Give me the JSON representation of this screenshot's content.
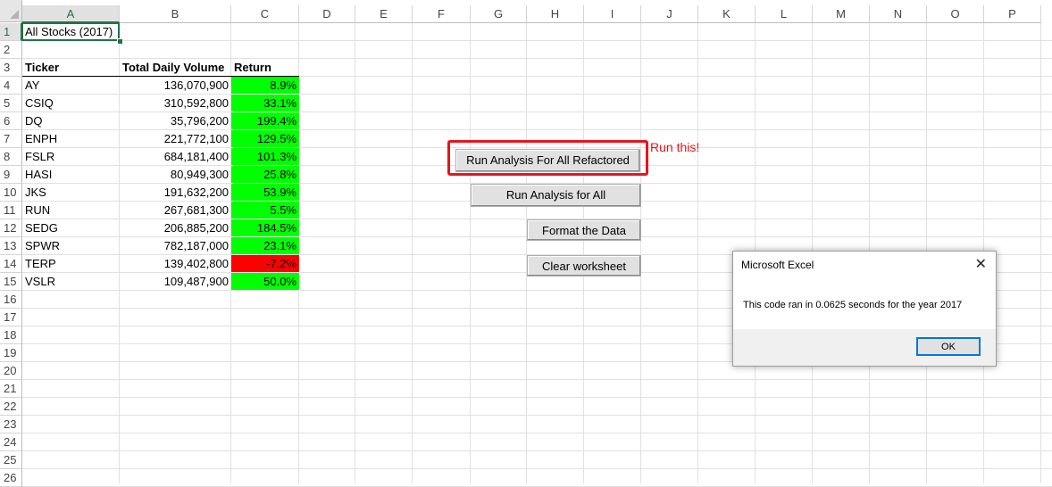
{
  "columns": [
    "A",
    "B",
    "C",
    "D",
    "E",
    "F",
    "G",
    "H",
    "I",
    "J",
    "K",
    "L",
    "M",
    "N",
    "O",
    "P"
  ],
  "rows": [
    "1",
    "2",
    "3",
    "4",
    "5",
    "6",
    "7",
    "8",
    "9",
    "10",
    "11",
    "12",
    "13",
    "14",
    "15",
    "16",
    "17",
    "18",
    "19",
    "20",
    "21",
    "22",
    "23",
    "24",
    "25",
    "26"
  ],
  "sheet": {
    "title": "All Stocks (2017)",
    "headers": {
      "ticker": "Ticker",
      "volume": "Total Daily Volume",
      "return": "Return"
    },
    "data": [
      {
        "ticker": "AY",
        "volume": "136,070,900",
        "return": "8.9%",
        "status": "positive"
      },
      {
        "ticker": "CSIQ",
        "volume": "310,592,800",
        "return": "33.1%",
        "status": "positive"
      },
      {
        "ticker": "DQ",
        "volume": "35,796,200",
        "return": "199.4%",
        "status": "positive"
      },
      {
        "ticker": "ENPH",
        "volume": "221,772,100",
        "return": "129.5%",
        "status": "positive"
      },
      {
        "ticker": "FSLR",
        "volume": "684,181,400",
        "return": "101.3%",
        "status": "positive"
      },
      {
        "ticker": "HASI",
        "volume": "80,949,300",
        "return": "25.8%",
        "status": "positive"
      },
      {
        "ticker": "JKS",
        "volume": "191,632,200",
        "return": "53.9%",
        "status": "positive"
      },
      {
        "ticker": "RUN",
        "volume": "267,681,300",
        "return": "5.5%",
        "status": "positive"
      },
      {
        "ticker": "SEDG",
        "volume": "206,885,200",
        "return": "184.5%",
        "status": "positive"
      },
      {
        "ticker": "SPWR",
        "volume": "782,187,000",
        "return": "23.1%",
        "status": "positive"
      },
      {
        "ticker": "TERP",
        "volume": "139,402,800",
        "return": "-7.2%",
        "status": "negative"
      },
      {
        "ticker": "VSLR",
        "volume": "109,487,900",
        "return": "50.0%",
        "status": "positive"
      }
    ]
  },
  "buttons": {
    "refactored": "Run Analysis For All Refactored",
    "run_all": "Run Analysis for All",
    "format": "Format the Data",
    "clear": "Clear worksheet"
  },
  "annotation": "Run this!",
  "dialog": {
    "title": "Microsoft Excel",
    "message": "This code ran in 0.0625 seconds for the year 2017",
    "ok": "OK"
  },
  "colors": {
    "positive": "#00ff00",
    "negative": "#ff0000",
    "highlight": "#e8141a",
    "accent": "#217346"
  }
}
